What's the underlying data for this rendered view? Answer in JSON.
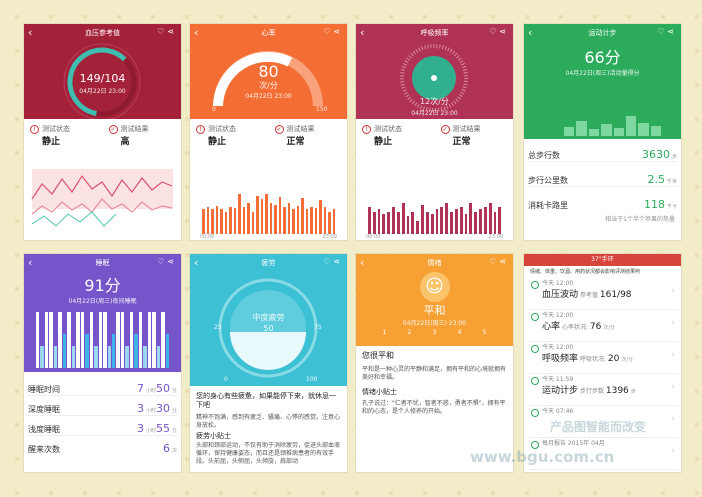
{
  "bp": {
    "title": "血压参考值",
    "value": "149/104",
    "date": "04月22日 23:00",
    "status_label": "测试状态",
    "status_val": "静止",
    "result_label": "测试结果",
    "result_val": "高"
  },
  "hr": {
    "title": "心率",
    "value": "80",
    "unit": "次/分",
    "date": "04月22日 23:00",
    "scale_min": "0",
    "scale_max": "150",
    "status_label": "测试状态",
    "status_val": "静止",
    "result_label": "测试结果",
    "result_val": "正常",
    "axis_start": "00:00",
    "axis_end": "23:00",
    "bars": [
      0.55,
      0.6,
      0.55,
      0.62,
      0.55,
      0.5,
      0.6,
      0.58,
      0.9,
      0.6,
      0.7,
      0.5,
      0.85,
      0.78,
      0.88,
      0.7,
      0.65,
      0.82,
      0.6,
      0.7,
      0.55,
      0.62,
      0.8,
      0.55,
      0.6,
      0.58,
      0.75,
      0.6,
      0.5,
      0.55
    ]
  },
  "resp": {
    "title": "呼吸频率",
    "value": "12",
    "unit": "次/分",
    "date": "04月22日 23:00",
    "status_label": "测试状态",
    "status_val": "静止",
    "result_label": "测试结果",
    "result_val": "正常",
    "axis_start": "00:00",
    "axis_end": "23:00",
    "bars": [
      0.6,
      0.5,
      0.55,
      0.45,
      0.5,
      0.6,
      0.48,
      0.7,
      0.4,
      0.5,
      0.3,
      0.65,
      0.5,
      0.45,
      0.55,
      0.6,
      0.68,
      0.5,
      0.55,
      0.6,
      0.45,
      0.7,
      0.5,
      0.55,
      0.6,
      0.7,
      0.5,
      0.6
    ]
  },
  "steps": {
    "title": "运动计步",
    "score": "66分",
    "subtitle": "04月22日(周三)活动量得分",
    "rows": [
      {
        "label": "总步行数",
        "value": "3630",
        "unit": "步"
      },
      {
        "label": "步行公里数",
        "value": "2.5",
        "unit": "千米"
      },
      {
        "label": "消耗卡路里",
        "value": "118",
        "unit": "千卡"
      }
    ],
    "note": "相当于1个半个苹果的热量"
  },
  "sleep": {
    "title": "睡眠",
    "score": "91分",
    "subtitle": "04月22日(周三)夜间睡眠",
    "rows": [
      {
        "label": "睡眠时间",
        "h": "7",
        "m": "50"
      },
      {
        "label": "深度睡眠",
        "h": "3",
        "m": "30"
      },
      {
        "label": "浅度睡眠",
        "h": "3",
        "m": "55"
      }
    ],
    "wake_label": "醒来次数",
    "wake_val": "6",
    "wake_unit": "次",
    "hour_unit": "小时",
    "min_unit": "分"
  },
  "fatigue": {
    "title": "疲劳",
    "gauge_label": "中度疲劳",
    "value": "50",
    "scale": [
      "0",
      "25",
      "75",
      "100"
    ],
    "heading": "您的身心有些疲惫，如果能停下来，就休息一下吧",
    "text": "精神不饱满，感到有疲乏、骚痛、心悸的感觉。注意心身放松。",
    "tip_title": "疲劳小贴士",
    "tip": "头部和颈部运动，不仅有助于消除疲劳，促进头部血液循环，保持健康姿态，而且还是颈椎病患者的有效手段。头前屈，头侧屈，头倾旋，肩部动"
  },
  "mood": {
    "title": "情绪",
    "value": "平和",
    "date": "04月22日(周三) 23:00",
    "scale": [
      "1",
      "2",
      "3",
      "4",
      "5"
    ],
    "heading": "您很平和",
    "text": "平和是一种心灵的平静和满足，拥有平和的心境就拥有美好和幸福。",
    "tip_title": "情绪小贴士",
    "tip": "孔子说过：\"仁者不忧，智者不惑，勇者不惧\"。拥有平和的心态，是个人修养的开始。"
  },
  "report": {
    "title": "37°手环",
    "notice": "情绪、体重、饮酒、用药状况都会影响评测结果哟",
    "records": [
      {
        "day": "今天",
        "time": "12:00",
        "label": "血压波动",
        "hint": "参考值",
        "value": "161/98"
      },
      {
        "day": "今天",
        "time": "12:00",
        "label": "心率",
        "hint": "心率状况:",
        "value": "76",
        "unit": "次/分"
      },
      {
        "day": "今天",
        "time": "12:00",
        "label": "呼吸频率",
        "hint": "呼吸状况:",
        "value": "20",
        "unit": "次/分"
      },
      {
        "day": "今天",
        "time": "11:59",
        "label": "运动计步",
        "hint": "步行步数",
        "value": "1396",
        "unit": "步"
      },
      {
        "day": "今天",
        "time": "07:46",
        "label": "",
        "hint": "",
        "value": ""
      },
      {
        "day": "每月报告",
        "time": "2015年 04月",
        "label": "",
        "hint": "",
        "value": ""
      }
    ]
  },
  "watermark": {
    "line1": "产品图智能而改变",
    "line2": "www.bgu.com.cn"
  },
  "colors": {
    "bp": "#a3223a",
    "hr": "#f46d35",
    "resp": "#b03254",
    "steps": "#2bab5b",
    "sleep": "#7654c9",
    "fatigue": "#3cc0d4",
    "mood": "#f7a135"
  }
}
